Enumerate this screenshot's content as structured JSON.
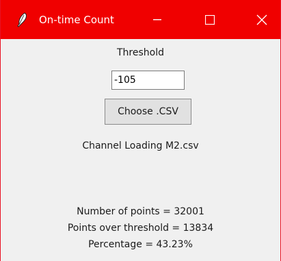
{
  "window": {
    "title": "On-time Count",
    "app_icon": "feather-icon",
    "controls": {
      "minimize_icon": "minimize-icon",
      "maximize_icon": "maximize-icon",
      "close_icon": "close-icon"
    },
    "colors": {
      "titlebar": "#f00000",
      "body": "#f0f0f0"
    }
  },
  "form": {
    "threshold_label": "Threshold",
    "threshold_value": "-105",
    "choose_button_label": "Choose .CSV",
    "file_label": "Channel Loading M2.csv"
  },
  "results": {
    "points": "Number of points = 32001",
    "over_threshold": "Points over threshold = 13834",
    "percentage": "Percentage = 43.23%"
  }
}
